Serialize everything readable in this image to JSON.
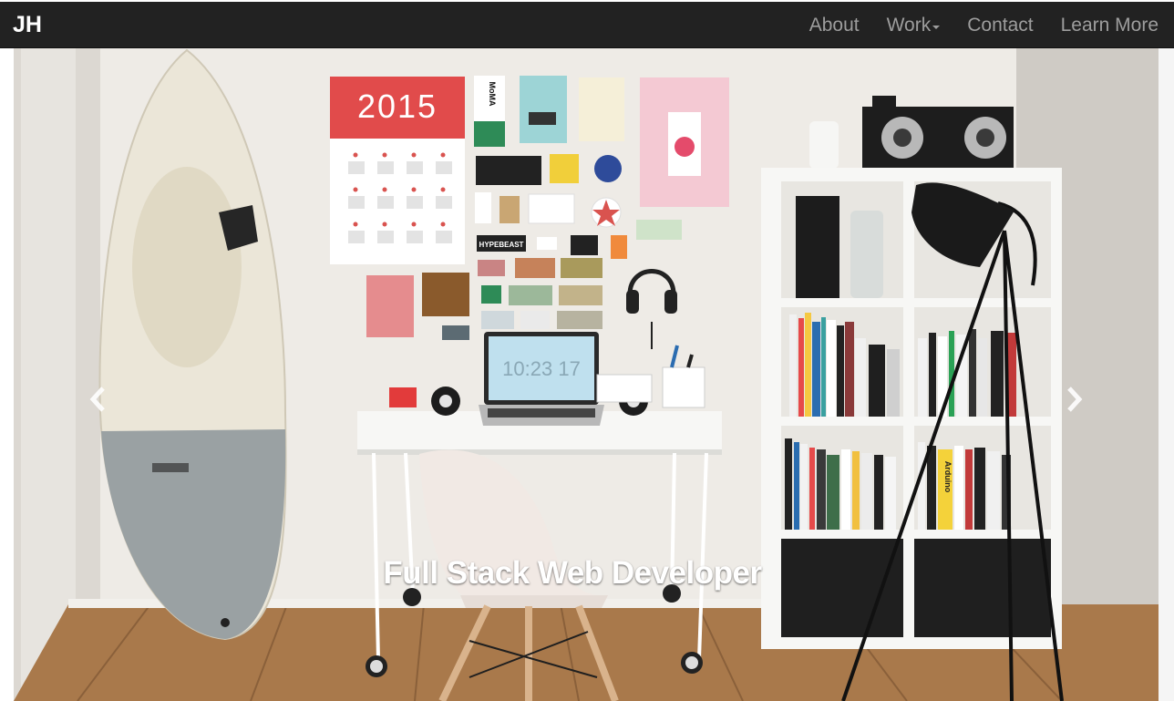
{
  "navbar": {
    "brand": "JH",
    "links": [
      {
        "label": "About"
      },
      {
        "label": "Work",
        "has_dropdown": true
      },
      {
        "label": "Contact"
      },
      {
        "label": "Learn More"
      }
    ]
  },
  "carousel": {
    "caption": "Full Stack Web Developer",
    "prev_icon": "chevron-left-icon",
    "next_icon": "chevron-right-icon",
    "image": {
      "calendar_year": "2015",
      "laptop_clock": "10:23 17",
      "poster_moma": "MoMA",
      "sticker_hypebeast": "HYPEBEAST",
      "book_spine": "Arduino"
    }
  },
  "colors": {
    "navbar_bg": "#222222",
    "nav_link": "#9d9d9d",
    "brand": "#ffffff",
    "caption": "#ffffff"
  }
}
